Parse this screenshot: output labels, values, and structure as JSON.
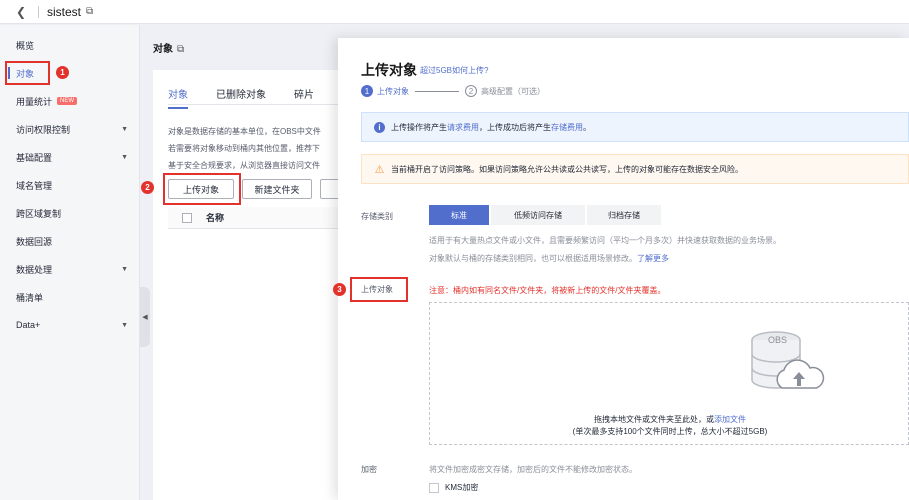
{
  "topbar": {
    "back_icon": "chevron-left-icon",
    "title": "sistest"
  },
  "sidebar": {
    "items": [
      {
        "label": "概览"
      },
      {
        "label": "对象"
      },
      {
        "label": "用量统计",
        "badge": "NEW"
      },
      {
        "label": "访问权限控制"
      },
      {
        "label": "基础配置"
      },
      {
        "label": "域名管理"
      },
      {
        "label": "跨区域复制"
      },
      {
        "label": "数据回源"
      },
      {
        "label": "数据处理"
      },
      {
        "label": "桶清单"
      },
      {
        "label": "Data+"
      }
    ]
  },
  "main": {
    "title": "对象",
    "tabs": [
      "对象",
      "已删除对象",
      "碎片"
    ],
    "desc_lines": [
      "对象是数据存储的基本单位，在OBS中文件",
      "若需要将对象移动到桶内其他位置，推荐下",
      "基于安全合规要求，从浏览器直接访问文件"
    ],
    "upload_button": "上传对象",
    "new_folder_button": "新建文件夹",
    "table_col_name": "名称"
  },
  "annotations": [
    "1",
    "2",
    "3"
  ],
  "drawer": {
    "title": "上传对象",
    "title_link": "超过5GB如何上传?",
    "steps": [
      {
        "num": "1",
        "label": "上传对象"
      },
      {
        "num": "2",
        "label": "高级配置（可选）"
      }
    ],
    "info_alert": {
      "pre": "上传操作将产生",
      "link1": "请求费用",
      "mid": "，上传成功后将产生",
      "link2": "存储费用",
      "post": "。"
    },
    "warn_alert": "当前桶开启了访问策略。如果访问策略允许公共读或公共读写，上传的对象可能存在数据安全风险。",
    "storage_label": "存储类别",
    "storage_options": [
      "标准",
      "低频访问存储",
      "归档存储"
    ],
    "storage_hint1": "适用于有大量热点文件或小文件，且需要频繁访问（平均一个月多次）并快速获取数据的业务场景。",
    "storage_hint2_pre": "对象默认与桶的存储类别相同，也可以根据适用场景修改。",
    "storage_hint2_link": "了解更多",
    "upload_label": "上传对象",
    "upload_warning": "注意：桶内如有同名文件/文件夹，将被新上传的文件/文件夹覆盖。",
    "drop_obs_label": "OBS",
    "drop_text_pre": "拖拽本地文件或文件夹至此处，或",
    "drop_text_link": "添加文件",
    "drop_text2": "(单次最多支持100个文件同时上传，总大小不超过5GB)",
    "encrypt_label": "加密",
    "encrypt_hint": "将文件加密成密文存储，加密后的文件不能修改加密状态。",
    "kms_label": "KMS加密"
  }
}
